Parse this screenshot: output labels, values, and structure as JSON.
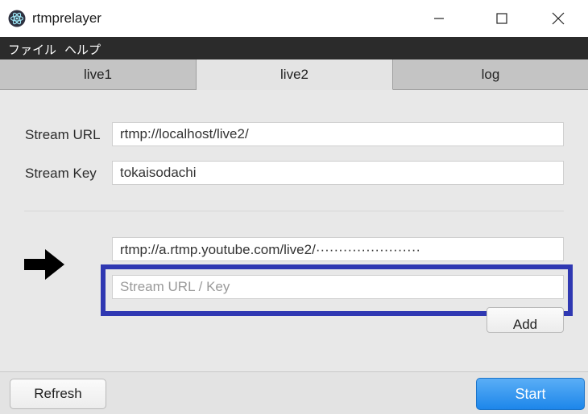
{
  "window": {
    "title": "rtmprelayer",
    "app_icon": "electron-atom-icon",
    "controls": [
      "minimize-icon",
      "maximize-icon",
      "close-icon"
    ]
  },
  "menu": {
    "file": "ファイル",
    "help": "ヘルプ"
  },
  "tabs": [
    {
      "label": "live1",
      "active": false
    },
    {
      "label": "live2",
      "active": true
    },
    {
      "label": "log",
      "active": false
    }
  ],
  "form": {
    "stream_url_label": "Stream URL",
    "stream_url_value": "rtmp://localhost/live2/",
    "stream_key_label": "Stream Key",
    "stream_key_value": "tokaisodachi"
  },
  "destinations": {
    "items": [
      "rtmp://a.rtmp.youtube.com/live2/·······················"
    ],
    "new_placeholder": "Stream URL / Key",
    "add_label": "Add"
  },
  "footer": {
    "refresh_label": "Refresh",
    "start_label": "Start"
  },
  "colors": {
    "highlight": "#2f38b2",
    "start_button": "#2a8ff0",
    "menubar": "#2b2b2b"
  }
}
